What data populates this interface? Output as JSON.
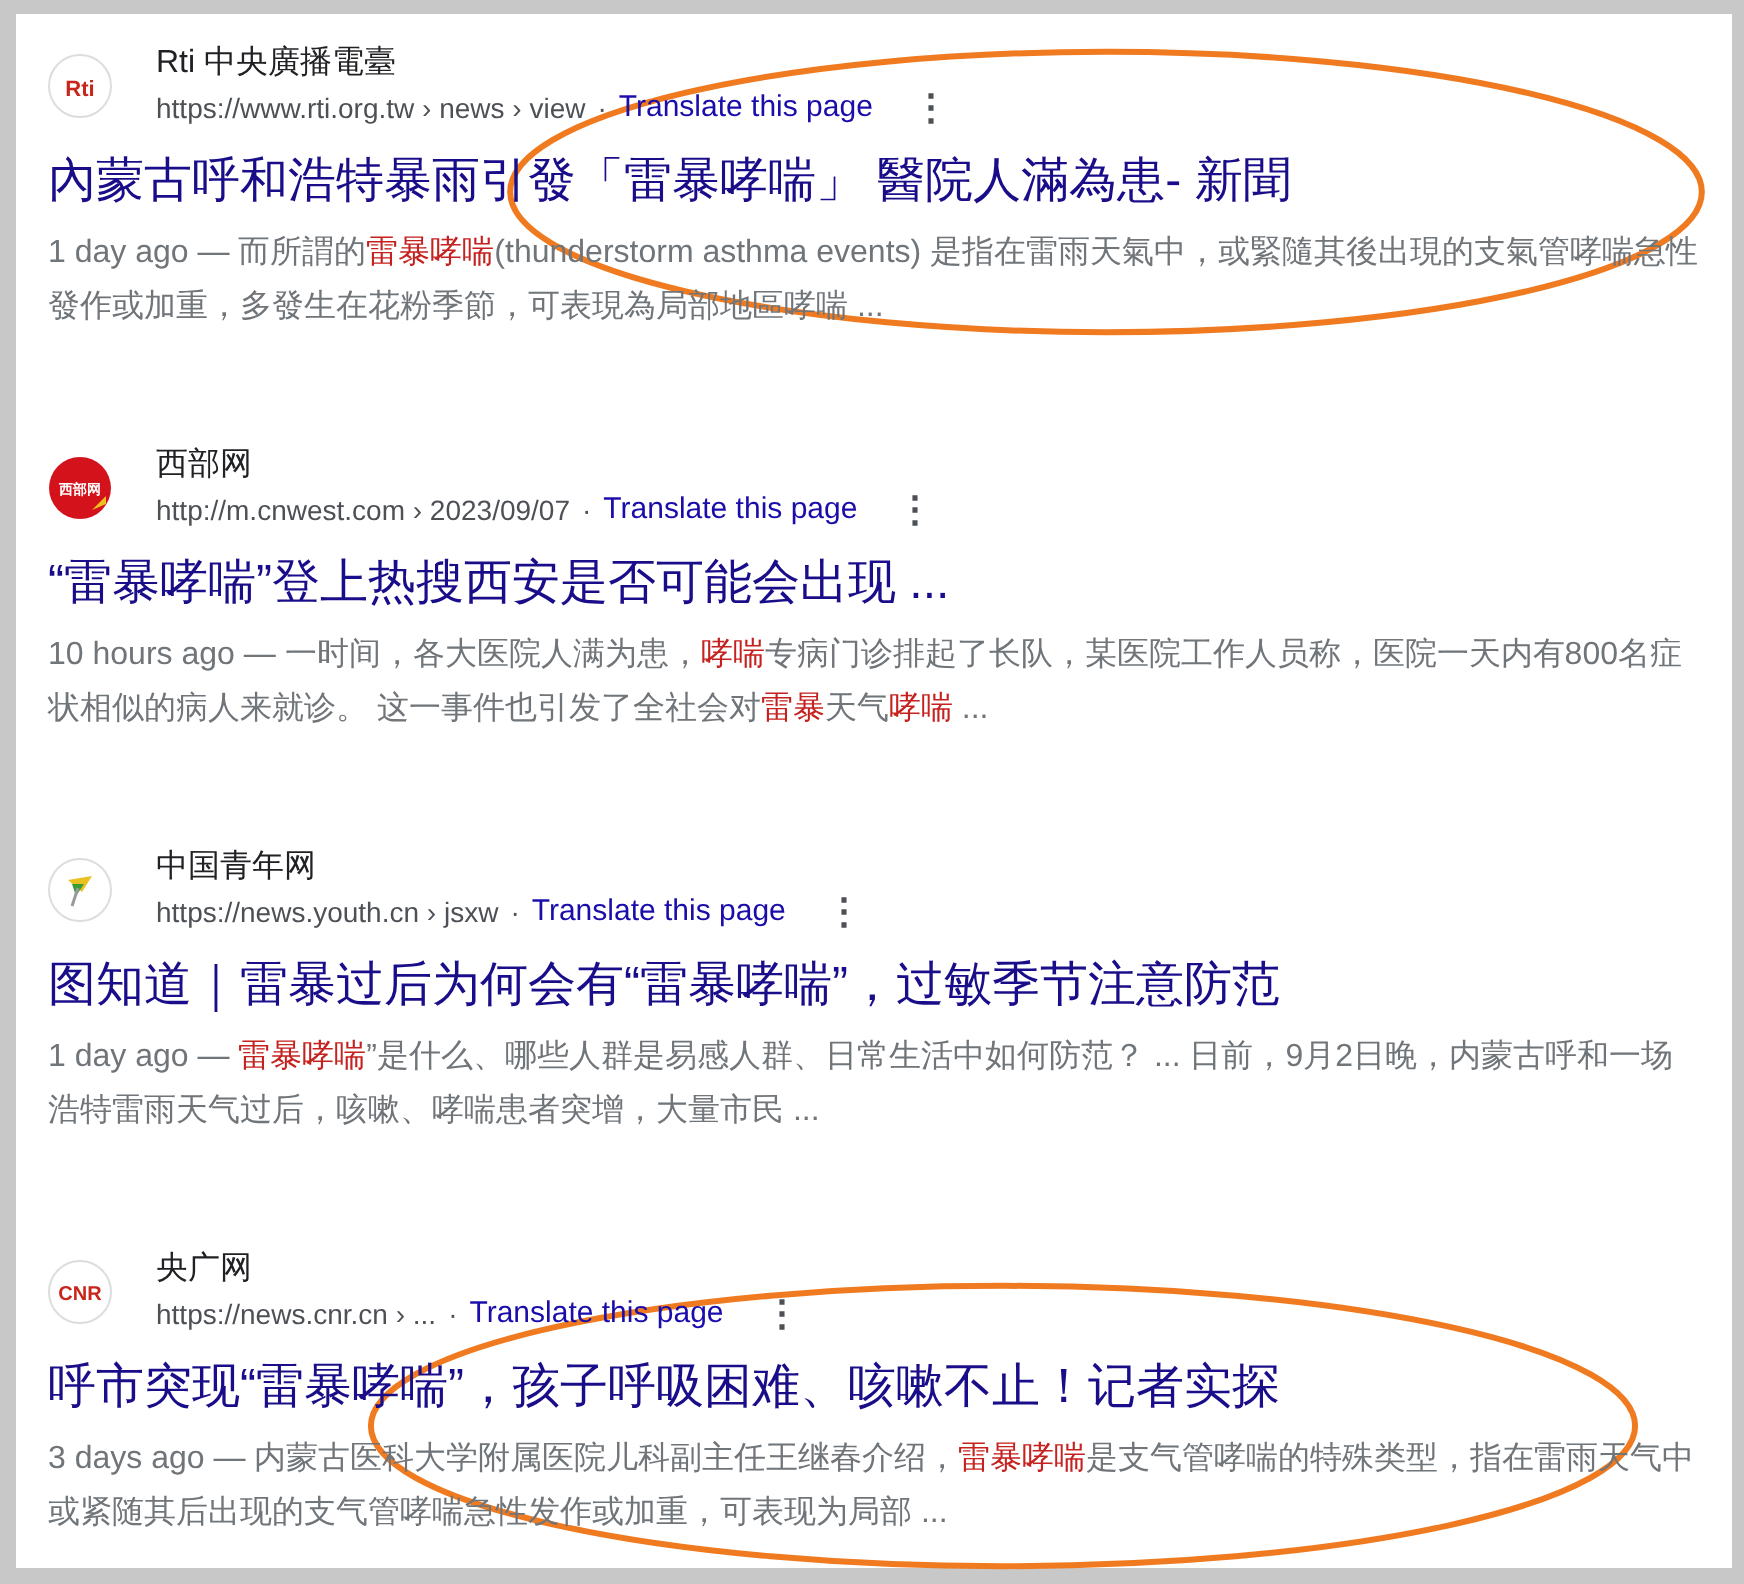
{
  "results": [
    {
      "logo": {
        "kind": "rti",
        "text": "Rti"
      },
      "site": "Rti 中央廣播電臺",
      "url": "https://www.rti.org.tw › news › view",
      "separator": "·",
      "translate": "Translate this page",
      "menu": "⋮",
      "title": "內蒙古呼和浩特暴雨引發「雷暴哮喘」 醫院人滿為患- 新聞",
      "circled": true,
      "snippet": [
        {
          "text": "1 day ago — 而所謂的",
          "highlight": false
        },
        {
          "text": "雷暴哮喘",
          "highlight": true
        },
        {
          "text": "(thunderstorm asthma events) 是指在雷雨天氣中，或緊隨其後出現的支氣管哮喘急性發作或加重，多發生在花粉季節，可表現為局部地區哮喘 ...",
          "highlight": false
        }
      ]
    },
    {
      "logo": {
        "kind": "cnwest",
        "text": "西部网"
      },
      "site": "西部网",
      "url": "http://m.cnwest.com › 2023/09/07",
      "separator": "·",
      "translate": "Translate this page",
      "menu": "⋮",
      "title": "“雷暴哮喘”登上热搜西安是否可能会出现 ...",
      "circled": false,
      "snippet": [
        {
          "text": "10 hours ago — 一时间，各大医院人满为患，",
          "highlight": false
        },
        {
          "text": "哮喘",
          "highlight": true
        },
        {
          "text": "专病门诊排起了长队，某医院工作人员称，医院一天内有800名症状相似的病人来就诊。 这一事件也引发了全社会对",
          "highlight": false
        },
        {
          "text": "雷暴",
          "highlight": true
        },
        {
          "text": "天气",
          "highlight": false
        },
        {
          "text": "哮喘",
          "highlight": true
        },
        {
          "text": " ...",
          "highlight": false
        }
      ]
    },
    {
      "logo": {
        "kind": "youth"
      },
      "site": "中国青年网",
      "url": "https://news.youth.cn › jsxw",
      "separator": "·",
      "translate": "Translate this page",
      "menu": "⋮",
      "title": "图知道｜雷暴过后为何会有“雷暴哮喘”，过敏季节注意防范",
      "circled": false,
      "snippet": [
        {
          "text": "1 day ago — ",
          "highlight": false
        },
        {
          "text": "雷暴哮喘",
          "highlight": true
        },
        {
          "text": "”是什么、哪些人群是易感人群、日常生活中如何防范？ ... 日前，9月2日晚，内蒙古呼和一场浩特雷雨天气过后，咳嗽、哮喘患者突增，大量市民 ...",
          "highlight": false
        }
      ]
    },
    {
      "logo": {
        "kind": "cnr",
        "text": "CNR"
      },
      "site": "央广网",
      "url": "https://news.cnr.cn › ...",
      "separator": "·",
      "translate": "Translate this page",
      "menu": "⋮",
      "title": "呼市突现“雷暴哮喘”，孩子呼吸困难、咳嗽不止！记者实探",
      "circled": true,
      "snippet": [
        {
          "text": "3 days ago — 内蒙古医科大学附属医院儿科副主任王继春介绍，",
          "highlight": false
        },
        {
          "text": "雷暴哮喘",
          "highlight": true
        },
        {
          "text": "是支气管哮喘的特殊类型，指在雷雨天气中或紧随其后出现的支气管哮喘急性发作或加重，可表现为局部 ...",
          "highlight": false
        }
      ]
    }
  ]
}
